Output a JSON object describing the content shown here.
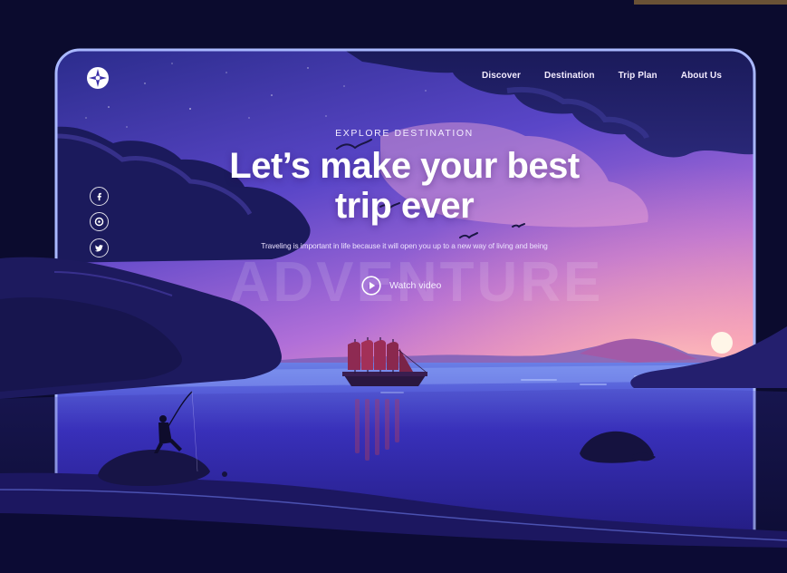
{
  "nav": {
    "items": [
      {
        "label": "Discover"
      },
      {
        "label": "Destination"
      },
      {
        "label": "Trip Plan"
      },
      {
        "label": "About Us"
      }
    ]
  },
  "hero": {
    "eyebrow": "EXPLORE DESTINATION",
    "headline_line1": "Let’s make your best",
    "headline_line2": "trip ever",
    "tagline": "Traveling is important in life because it will open you up to a new way of living and being",
    "watermark": "ADVENTURE",
    "watch_label": "Watch video"
  },
  "social": [
    "facebook-icon",
    "dribbble-icon",
    "twitter-icon"
  ],
  "colors": {
    "frame_border": "#9fb0ff",
    "sky_top": "#2a2a8a",
    "sky_mid": "#7a54d6",
    "sunset": "#f7a0b8",
    "water": "#3a2ec0",
    "dark_land": "#151446"
  }
}
